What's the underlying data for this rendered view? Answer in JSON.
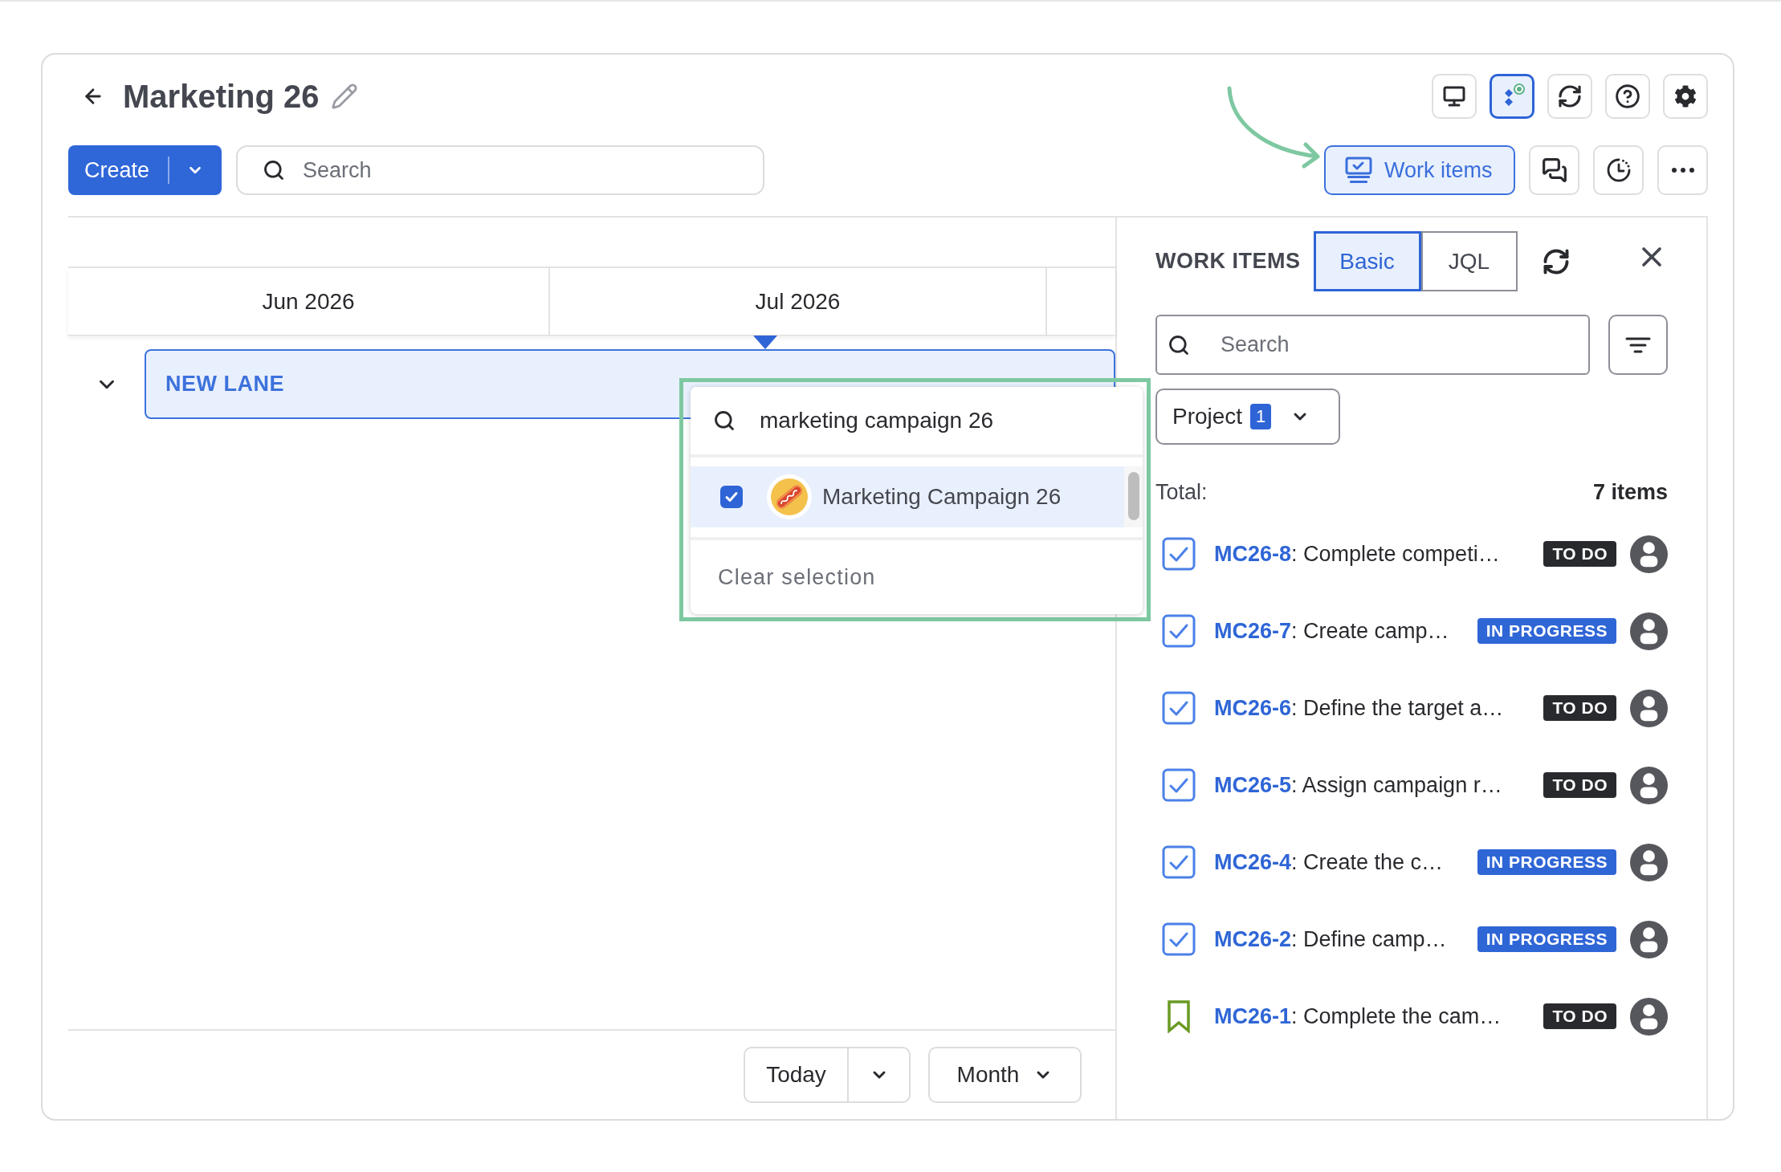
{
  "header": {
    "title": "Marketing 26",
    "create_label": "Create",
    "search": {
      "placeholder": "Search"
    }
  },
  "toolbar_buttons": [
    {
      "selected": false
    },
    {
      "selected": true
    },
    {
      "selected": false
    },
    {
      "selected": false
    },
    {
      "selected": false
    }
  ],
  "work_items_button": {
    "label": "Work items",
    "selected": true
  },
  "timeline": {
    "months": [
      "Jun 2026",
      "Jul 2026"
    ],
    "lanes": [
      {
        "name": "NEW LANE",
        "expanded": true
      }
    ],
    "today_label": "Today",
    "scale_label": "Month"
  },
  "project_picker": {
    "query": "marketing campaign 26",
    "options": [
      {
        "label": "Marketing Campaign 26",
        "checked": true
      }
    ],
    "clear_label": "Clear selection"
  },
  "panel": {
    "title": "WORK ITEMS",
    "tabs": [
      {
        "label": "Basic",
        "selected": true
      },
      {
        "label": "JQL",
        "selected": false
      }
    ],
    "search": {
      "placeholder": "Search"
    },
    "filters": [
      {
        "label": "Project",
        "count": "1"
      }
    ],
    "total_label": "Total:",
    "total_count": "7 items",
    "items": [
      {
        "kind": "task",
        "key": "MC26-8",
        "summary": ": Complete competi…",
        "status": {
          "label": "TO DO",
          "kind": "todo"
        }
      },
      {
        "kind": "task",
        "key": "MC26-7",
        "summary": ": Create camp…",
        "status": {
          "label": "IN PROGRESS",
          "kind": "in_progress"
        }
      },
      {
        "kind": "task",
        "key": "MC26-6",
        "summary": ": Define the target a…",
        "status": {
          "label": "TO DO",
          "kind": "todo"
        }
      },
      {
        "kind": "task",
        "key": "MC26-5",
        "summary": ": Assign campaign r…",
        "status": {
          "label": "TO DO",
          "kind": "todo"
        }
      },
      {
        "kind": "task",
        "key": "MC26-4",
        "summary": ": Create the c…",
        "status": {
          "label": "IN PROGRESS",
          "kind": "in_progress"
        }
      },
      {
        "kind": "task",
        "key": "MC26-2",
        "summary": ": Define camp…",
        "status": {
          "label": "IN PROGRESS",
          "kind": "in_progress"
        }
      },
      {
        "kind": "story",
        "key": "MC26-1",
        "summary": ": Complete the cam…",
        "status": {
          "label": "TO DO",
          "kind": "todo"
        }
      }
    ]
  }
}
